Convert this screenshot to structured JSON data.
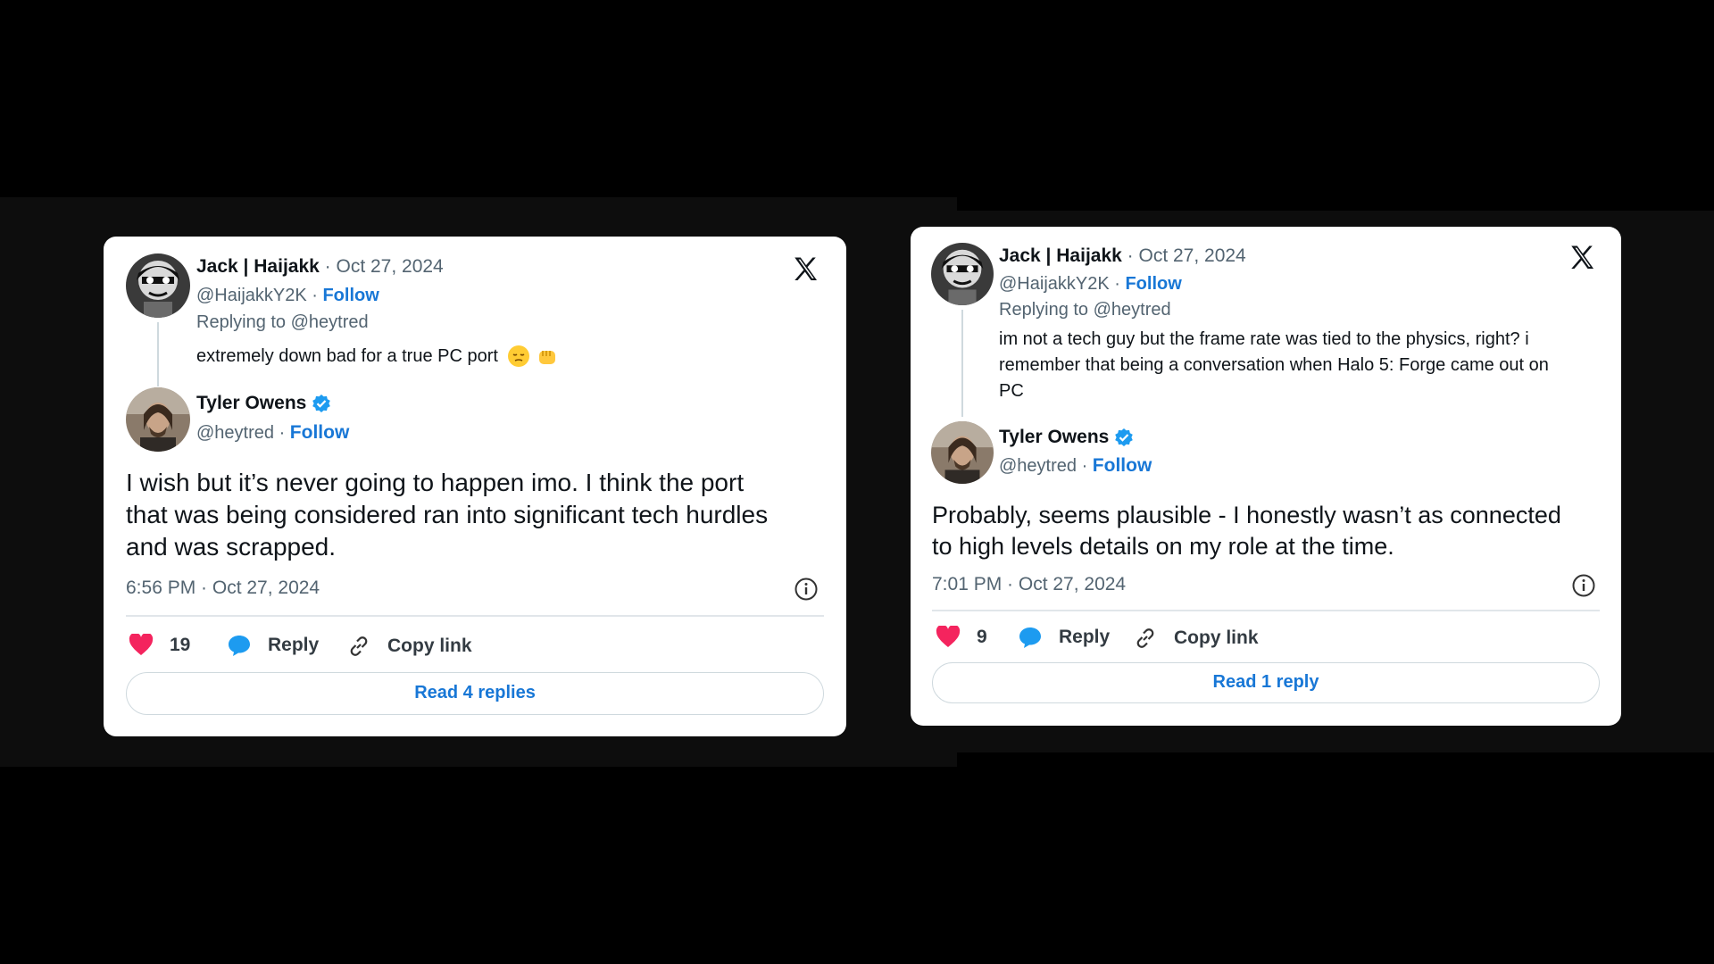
{
  "cards": [
    {
      "parent": {
        "name": "Jack | Haijakk",
        "date": "· Oct 27, 2024",
        "handle": "@HaijakkY2K ·",
        "follow": "Follow",
        "replying": "Replying to @heytred",
        "text": "extremely down bad for a true PC port"
      },
      "reply": {
        "name": "Tyler Owens",
        "handle": "@heytred ·",
        "follow": "Follow",
        "text_lines": [
          "I wish but it’s never going to happen imo. I think the port",
          "that was being considered ran into significant tech hurdles",
          "and was scrapped."
        ],
        "timestamp": "6:56 PM · Oct 27, 2024"
      },
      "likes": "19",
      "reply_label": "Reply",
      "copy_label": "Copy link",
      "read_label": "Read 4 replies"
    },
    {
      "parent": {
        "name": "Jack | Haijakk",
        "date": "· Oct 27, 2024",
        "handle": "@HaijakkY2K ·",
        "follow": "Follow",
        "replying": "Replying to @heytred",
        "text_lines": [
          "im not a tech guy but the frame rate was tied to the physics, right? i",
          "remember that being a conversation when Halo 5: Forge came out on",
          "PC"
        ]
      },
      "reply": {
        "name": "Tyler Owens",
        "handle": "@heytred ·",
        "follow": "Follow",
        "text_lines": [
          "Probably, seems plausible - I honestly wasn’t as connected",
          "to high levels details on my role at the time."
        ],
        "timestamp": "7:01 PM · Oct 27, 2024"
      },
      "likes": "9",
      "reply_label": "Reply",
      "copy_label": "Copy link",
      "read_label": "Read 1 reply"
    }
  ],
  "colors": {
    "background": "#000000",
    "card": "#ffffff",
    "link": "#1877d6",
    "heart": "#f4245e",
    "bubble": "#1d9bf0",
    "verified": "#1d9bf0"
  },
  "icons": [
    "x-logo-icon",
    "verified-badge-icon",
    "heart-icon",
    "reply-bubble-icon",
    "link-icon",
    "info-icon"
  ]
}
